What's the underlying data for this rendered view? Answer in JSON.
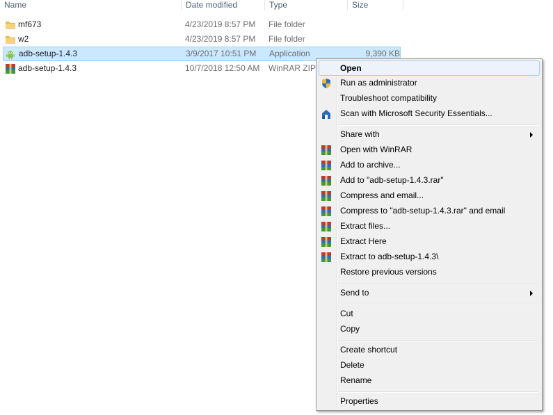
{
  "columns": {
    "name": "Name",
    "date_modified": "Date modified",
    "type": "Type",
    "size": "Size"
  },
  "files": [
    {
      "name": "mf673",
      "date": "4/23/2019 8:57 PM",
      "type": "File folder",
      "size": "",
      "icon": "folder-icon"
    },
    {
      "name": "w2",
      "date": "4/23/2019 8:57 PM",
      "type": "File folder",
      "size": "",
      "icon": "folder-icon"
    },
    {
      "name": "adb-setup-1.4.3",
      "date": "3/9/2017 10:51 PM",
      "type": "Application",
      "size": "9,390 KB",
      "icon": "android-app-icon",
      "selected": true
    },
    {
      "name": "adb-setup-1.4.3",
      "date": "10/7/2018 12:50 AM",
      "type": "WinRAR ZIP",
      "size": "",
      "icon": "winrar-archive-icon"
    }
  ],
  "context_menu": {
    "open": "Open",
    "run_as_admin": "Run as administrator",
    "troubleshoot": "Troubleshoot compatibility",
    "scan_mse": "Scan with Microsoft Security Essentials...",
    "share_with": "Share with",
    "open_winrar": "Open with WinRAR",
    "add_archive": "Add to archive...",
    "add_to_rar": "Add to \"adb-setup-1.4.3.rar\"",
    "compress_email": "Compress and email...",
    "compress_rar_email": "Compress to \"adb-setup-1.4.3.rar\" and email",
    "extract_files": "Extract files...",
    "extract_here": "Extract Here",
    "extract_to": "Extract to adb-setup-1.4.3\\",
    "restore_versions": "Restore previous versions",
    "send_to": "Send to",
    "cut": "Cut",
    "copy": "Copy",
    "create_shortcut": "Create shortcut",
    "delete": "Delete",
    "rename": "Rename",
    "properties": "Properties"
  },
  "colors": {
    "selection_bg": "#cce8ff",
    "menu_bg": "#f0f0f0",
    "menu_highlight": "#ecf3fb",
    "header_text": "#4c607a"
  }
}
